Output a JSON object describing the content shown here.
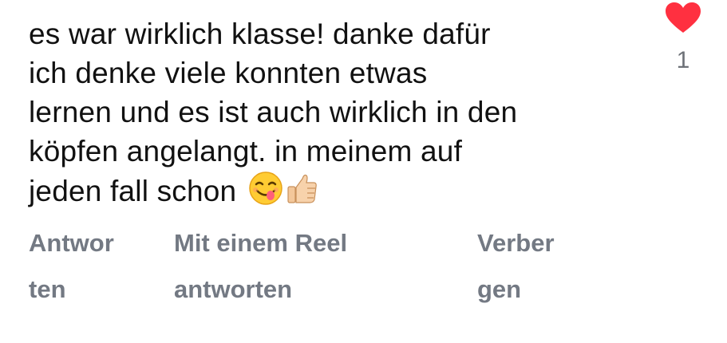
{
  "comment": {
    "text_lines": [
      "es war wirklich klasse! danke dafür",
      "ich denke viele konnten etwas",
      "lernen und es ist auch wirklich in den",
      "köpfen angelangt. in meinem auf",
      "jeden fall schon"
    ],
    "emojis": [
      "yum-face-emoji",
      "thumbs-up-emoji"
    ]
  },
  "like": {
    "icon": "heart-icon",
    "count": "1",
    "color": "#ff3040"
  },
  "actions": {
    "reply_lines": [
      "Antwor",
      "ten"
    ],
    "reel_lines": [
      "Mit einem Reel",
      "antworten"
    ],
    "hide_lines": [
      "Verber",
      "gen"
    ]
  }
}
